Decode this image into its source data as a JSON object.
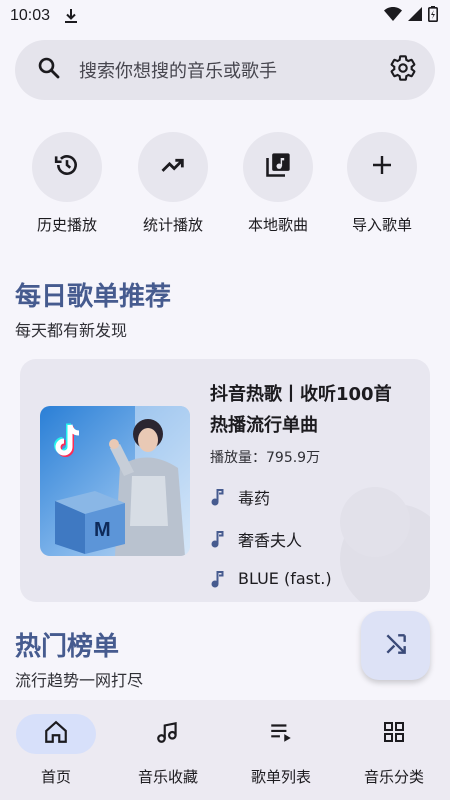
{
  "status_bar": {
    "time": "10:03"
  },
  "search": {
    "placeholder": "搜索你想搜的音乐或歌手"
  },
  "quick_actions": [
    {
      "label": "历史播放",
      "icon": "history-icon"
    },
    {
      "label": "统计播放",
      "icon": "trending-up-icon"
    },
    {
      "label": "本地歌曲",
      "icon": "library-music-icon"
    },
    {
      "label": "导入歌单",
      "icon": "plus-icon"
    }
  ],
  "daily": {
    "title": "每日歌单推荐",
    "subtitle": "每天都有新发现",
    "playlist": {
      "title_line1": "抖音热歌丨收听100首",
      "title_line2": "热播流行单曲",
      "plays": "播放量：795.9万",
      "songs": [
        "毒药",
        "奢香夫人",
        "BLUE (fast.)"
      ]
    }
  },
  "hot": {
    "title": "热门榜单",
    "subtitle": "流行趋势一网打尽"
  },
  "bottom_nav": [
    {
      "label": "首页",
      "icon": "home-icon",
      "active": true
    },
    {
      "label": "音乐收藏",
      "icon": "music-collection-icon",
      "active": false
    },
    {
      "label": "歌单列表",
      "icon": "playlist-icon",
      "active": false
    },
    {
      "label": "音乐分类",
      "icon": "category-grid-icon",
      "active": false
    }
  ],
  "colors": {
    "accent_title": "#465b8f",
    "background": "#f6f5fb",
    "active_tab": "#d7e0fa"
  }
}
